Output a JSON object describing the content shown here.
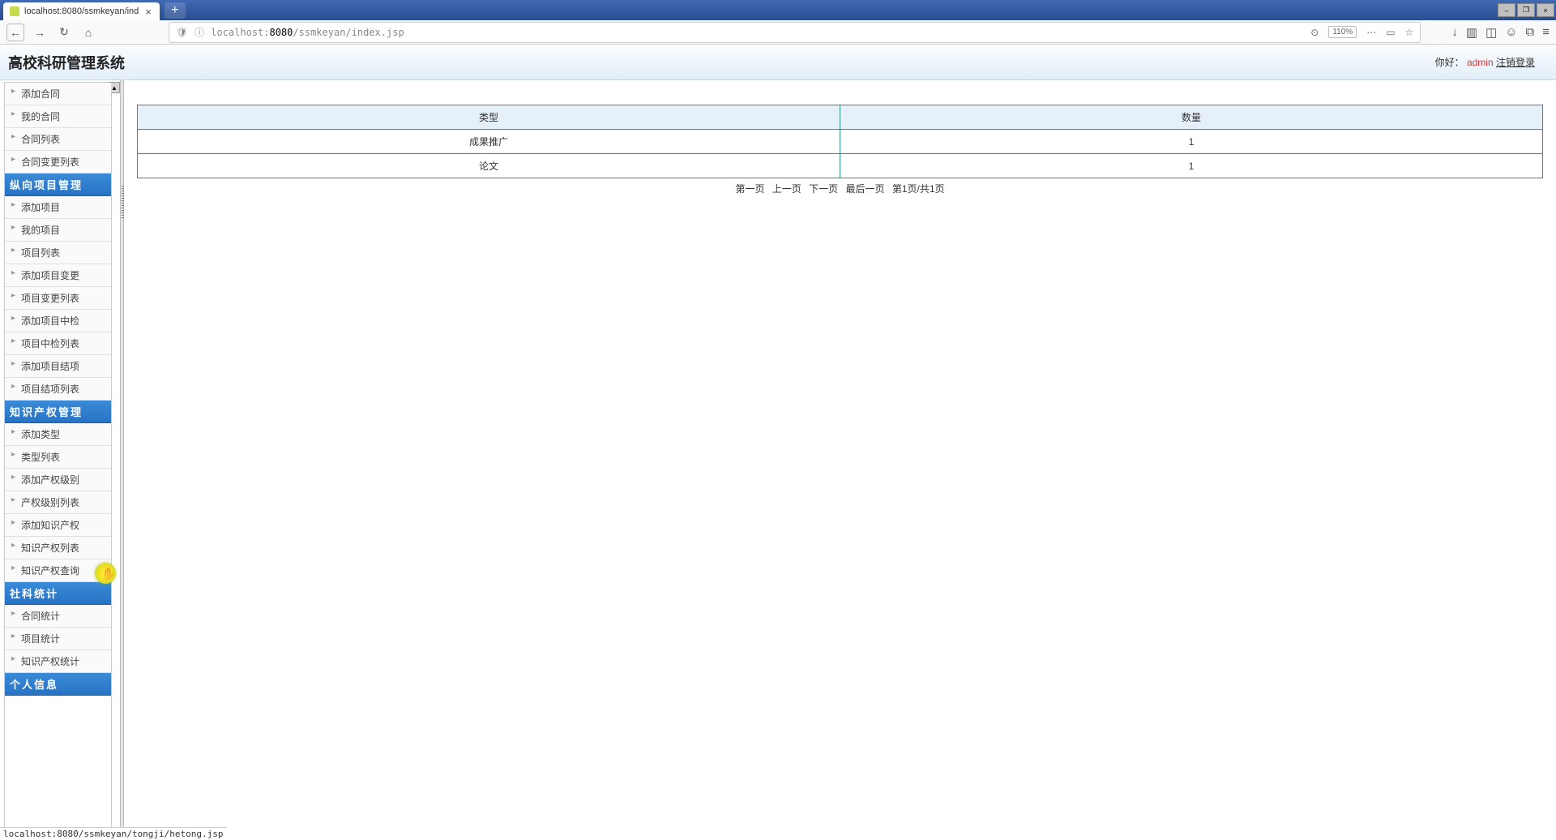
{
  "browser": {
    "tab_title": "localhost:8080/ssmkeyan/ind",
    "url_prefix": "localhost:",
    "url_port": "8080",
    "url_path": "/ssmkeyan/index.jsp",
    "zoom": "110%",
    "status_url": "localhost:8080/ssmkeyan/tongji/hetong.jsp"
  },
  "app": {
    "title": "高校科研管理系统",
    "greeting": "你好：",
    "username": "admin",
    "logout": "注销登录"
  },
  "sidebar": {
    "items": [
      "添加合同",
      "我的合同",
      "合同列表",
      "合同变更列表"
    ],
    "group2_header": "纵向项目管理",
    "group2": [
      "添加项目",
      "我的项目",
      "项目列表",
      "添加项目变更",
      "项目变更列表",
      "添加项目中检",
      "项目中检列表",
      "添加项目结项",
      "项目结项列表"
    ],
    "group3_header": "知识产权管理",
    "group3": [
      "添加类型",
      "类型列表",
      "添加产权级别",
      "产权级别列表",
      "添加知识产权",
      "知识产权列表",
      "知识产权查询"
    ],
    "group4_header": "社科统计",
    "group4": [
      "合同统计",
      "项目统计",
      "知识产权统计"
    ],
    "group5_header": "个人信息"
  },
  "table": {
    "headers": [
      "类型",
      "数量"
    ],
    "rows": [
      {
        "type": "成果推广",
        "count": "1"
      },
      {
        "type": "论文",
        "count": "1"
      }
    ]
  },
  "pagination": {
    "first": "第一页",
    "prev": "上一页",
    "next": "下一页",
    "last": "最后一页",
    "info": "第1页/共1页"
  }
}
